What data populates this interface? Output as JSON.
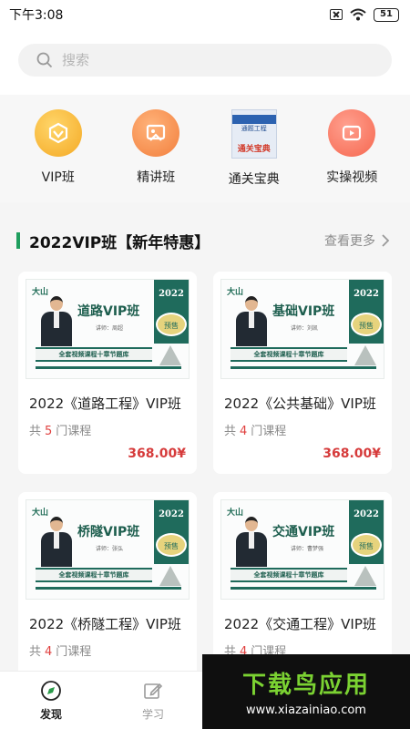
{
  "status_bar": {
    "time": "下午3:08",
    "battery": "51"
  },
  "search": {
    "placeholder": "搜索"
  },
  "categories": [
    {
      "label": "VIP班",
      "icon": "vip-icon"
    },
    {
      "label": "精讲班",
      "icon": "lecture-icon"
    },
    {
      "label": "通关宝典",
      "icon": "book-cover-icon",
      "book_top": "通题工程",
      "book_title": "通关宝典"
    },
    {
      "label": "实操视频",
      "icon": "video-play-icon"
    }
  ],
  "section": {
    "title": "2022VIP班【新年特惠】",
    "more": "查看更多"
  },
  "courses": [
    {
      "title": "2022《道路工程》VIP班",
      "count_prefix": "共",
      "count": "5",
      "count_suffix": "门课程",
      "price": "368.00¥",
      "thumb_class": "道路VIP班",
      "thumb_lecturer": "讲师：周超",
      "year": "2022",
      "presale": "预售",
      "banner": "全套视频课程十章节题库",
      "logo": "大山"
    },
    {
      "title": "2022《公共基础》VIP班",
      "count_prefix": "共",
      "count": "4",
      "count_suffix": "门课程",
      "price": "368.00¥",
      "thumb_class": "基础VIP班",
      "thumb_lecturer": "讲师：刘凯",
      "year": "2022",
      "presale": "预售",
      "banner": "全套视频课程十章节题库",
      "logo": "大山"
    },
    {
      "title": "2022《桥隧工程》VIP班",
      "count_prefix": "共",
      "count": "4",
      "count_suffix": "门课程",
      "price": "",
      "thumb_class": "桥隧VIP班",
      "thumb_lecturer": "讲师：张弘",
      "year": "2022",
      "presale": "预售",
      "banner": "全套视频课程十章节题库",
      "logo": "大山"
    },
    {
      "title": "2022《交通工程》VIP班",
      "count_prefix": "共",
      "count": "4",
      "count_suffix": "门课程",
      "price": "",
      "thumb_class": "交通VIP班",
      "thumb_lecturer": "讲师：曹梦强",
      "year": "2022",
      "presale": "预售",
      "banner": "全套视频课程十章节题库",
      "logo": "大山"
    }
  ],
  "bottom_nav": [
    {
      "label": "发现",
      "icon": "compass-icon",
      "active": true
    },
    {
      "label": "学习",
      "icon": "edit-icon",
      "active": false
    }
  ],
  "watermark": {
    "title": "下载鸟应用",
    "url": "www.xiazainiao.com"
  }
}
